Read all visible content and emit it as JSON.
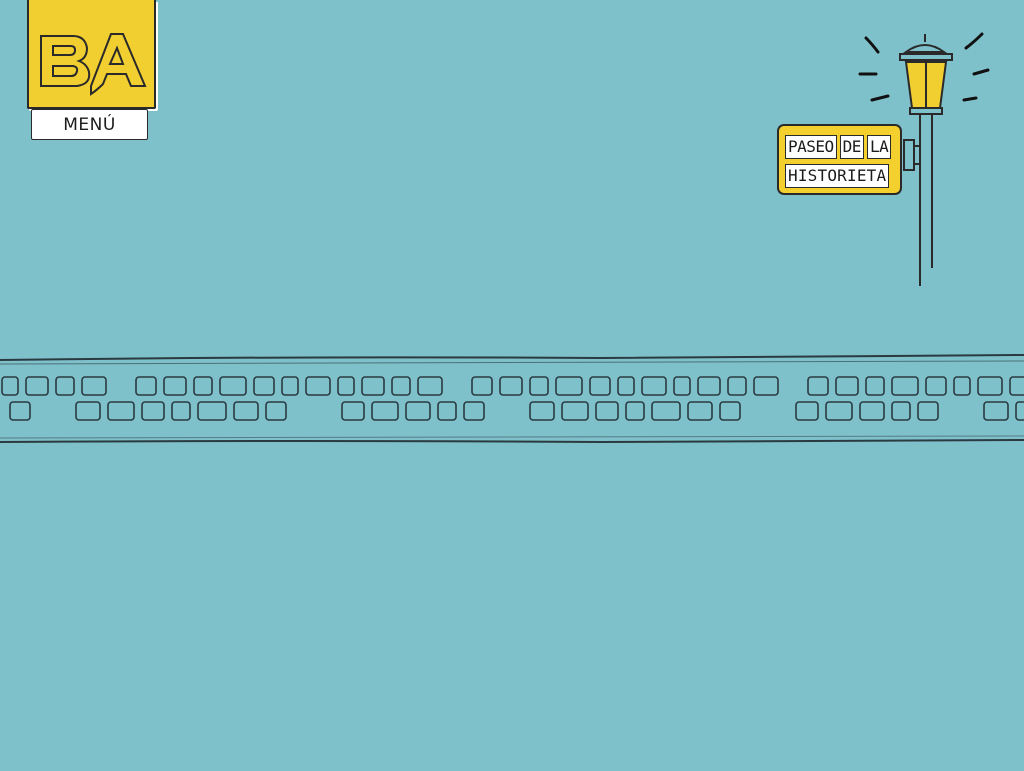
{
  "header": {
    "logo_text": "BA",
    "menu_label": "MENÚ"
  },
  "street_sign": {
    "line1_words": [
      "PASEO",
      "DE",
      "LA"
    ],
    "line2_words": [
      "HISTORIETA"
    ]
  },
  "icons": {
    "logo": "ba-logo-icon",
    "lamp": "street-lamp-icon",
    "road": "cobblestone-street-decoration"
  },
  "colors": {
    "background": "#7fc1cb",
    "accent_yellow": "#f2cf30",
    "ink": "#2a2a2a",
    "white": "#ffffff"
  }
}
